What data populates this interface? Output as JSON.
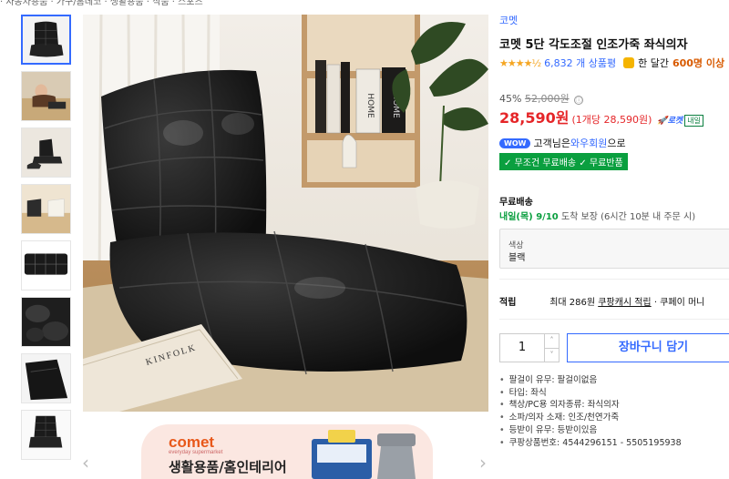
{
  "top_strip": "· 자동차용품 · 가구/홈데코 · 생활용품 · 식품 · 스포츠",
  "product": {
    "brand": "코멧",
    "title": "코멧 5단 각도조절 인조가죽 좌식의자",
    "rating_stars": "★★★★½",
    "rating_value": 4.5,
    "review_count": "6,832 개 상품평",
    "sold_label": "한 달간",
    "sold_count": "600명 이상",
    "discount": "45%",
    "original_price": "52,000원",
    "info_icon": "ⓘ",
    "price": "28,590원",
    "unit_price": "(1개당 28,590원)",
    "rocket_label": "🚀로켓",
    "rocket_day": "내일"
  },
  "wow": {
    "badge": "WOW",
    "text_prefix": "고객님은",
    "link": "와우회원",
    "text_suffix": "으로"
  },
  "free_shipping": "✓ 무조건 무료배송 ✓ 무료반품",
  "delivery": {
    "section_label": "무료배송",
    "day": "내일(목) 9/10",
    "guarantee": "도착 보장",
    "note": "(6시간 10분 내 주문 시)"
  },
  "option": {
    "label": "색상",
    "value": "블랙"
  },
  "cash": {
    "label": "적립",
    "text": "최대 286원",
    "link": "쿠팡캐시 적립",
    "suffix": "· 쿠페이 머니"
  },
  "quantity": "1",
  "qty_up": "˄",
  "qty_down": "˅",
  "cart_button": "장바구니 담기",
  "specs": [
    "팔걸이 유무: 팔걸이없음",
    "타입: 좌식",
    "책상/PC용 의자종류: 좌식의자",
    "소파/의자 소재: 인조/천연가죽",
    "등받이 유무: 등받이있음",
    "쿠팡상품번호: 4544296151 - 5505195938"
  ],
  "banner": {
    "logo": "comet",
    "logo_sub": "everyday supermarket",
    "title": "생활용품/홈인테리어"
  },
  "nav": {
    "prev": "‹",
    "next": "›"
  },
  "book": {
    "title": "KINFOLK",
    "spine1": "HOME",
    "spine2": "HOME"
  },
  "colors": {
    "accent": "#346aff",
    "price": "#e52528",
    "green": "#0a9f3f",
    "sold": "#d85a00"
  }
}
